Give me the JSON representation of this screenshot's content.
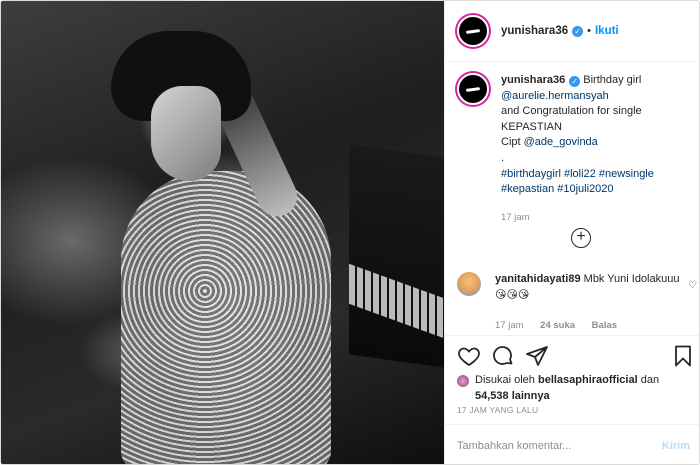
{
  "header": {
    "username": "yunishara36",
    "separator": "•",
    "follow_label": "Ikuti"
  },
  "caption": {
    "username": "yunishara36",
    "line1": "Birthday girl",
    "mention1": "@aurelie.hermansyah",
    "line2": "and Congratulation for single",
    "line3": "KEPASTIAN",
    "cipt": "Cipt",
    "mention2": "@ade_govinda",
    "dot": ".",
    "hashtags_line1": "#birthdaygirl #loli22 #newsingle",
    "hashtags_line2": "#kepastian #10juli2020",
    "time": "17 jam"
  },
  "comment": {
    "username": "yanitahidayati89",
    "text": "Mbk Yuni Idolakuuu😘😘😘",
    "time": "17 jam",
    "likes": "24 suka",
    "reply": "Balas"
  },
  "likes": {
    "prefix": "Disukai oleh",
    "user": "bellasaphiraofficial",
    "conj": "dan",
    "count": "54,538 lainnya"
  },
  "posted": "17 JAM YANG LALU",
  "comment_box": {
    "placeholder": "Tambahkan komentar...",
    "post_label": "Kirim"
  },
  "colors": {
    "link": "#00376b",
    "follow": "#0095f6",
    "verified": "#3897f0",
    "muted": "#8e8e8e"
  }
}
